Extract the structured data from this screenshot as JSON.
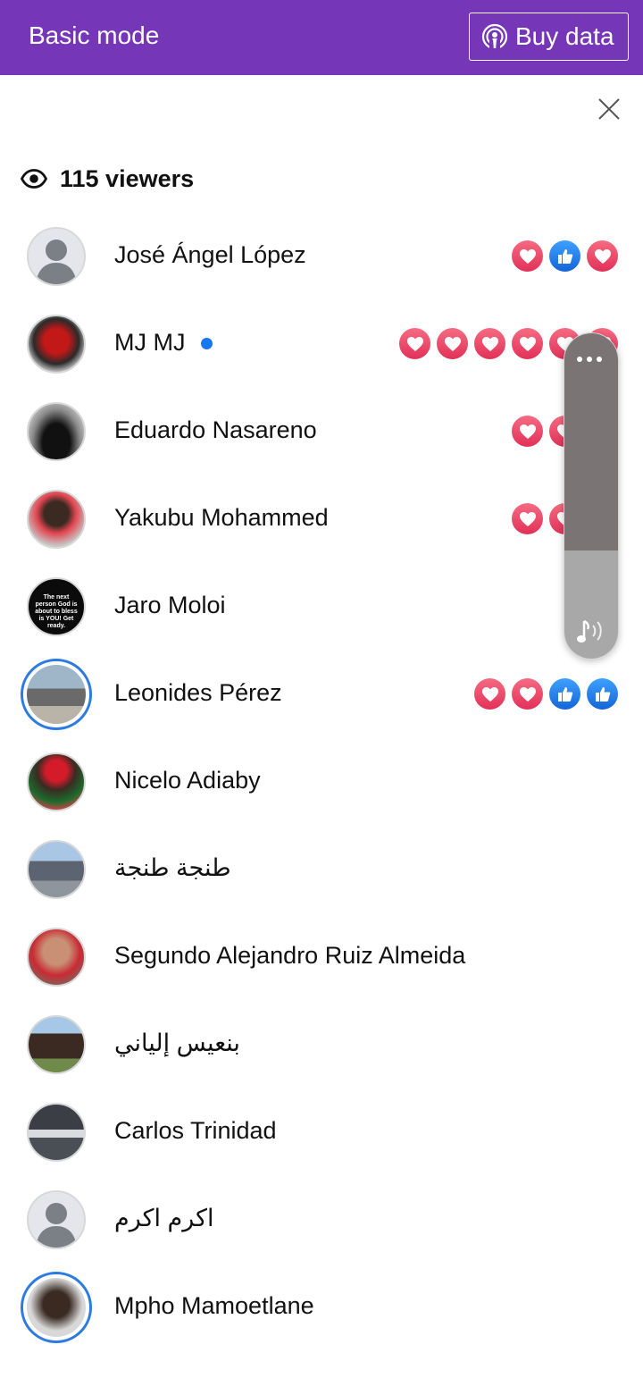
{
  "header": {
    "title": "Basic mode",
    "buy_label": "Buy data",
    "background": "#7536b7"
  },
  "viewers": {
    "count_label": "115 viewers"
  },
  "viewer_list": [
    {
      "name": "José Ángel López",
      "avatar": "default-avatar",
      "reactions": [
        "love",
        "like",
        "love"
      ]
    },
    {
      "name": "MJ MJ",
      "avatar": "red-car-photo",
      "online": true,
      "reactions": [
        "love",
        "love",
        "love",
        "love",
        "love",
        "love"
      ]
    },
    {
      "name": "Eduardo Nasareno",
      "avatar": "man-in-black-photo",
      "reactions": [
        "love",
        "love",
        "love"
      ]
    },
    {
      "name": "Yakubu Mohammed",
      "avatar": "man-portrait-photo",
      "reactions": [
        "love",
        "love",
        "love"
      ]
    },
    {
      "name": "Jaro Moloi",
      "avatar": "quote-image",
      "avatar_text": "The next person God is about to bless is YOU! Get ready.",
      "reactions": []
    },
    {
      "name": "Leonides Pérez",
      "avatar": "motorcycle-photo",
      "story_ring": true,
      "reactions": [
        "love",
        "love",
        "like",
        "like"
      ]
    },
    {
      "name": "Nicelo Adiaby",
      "avatar": "red-cap-photo",
      "reactions": []
    },
    {
      "name": "طنجة طنجة",
      "avatar": "silver-car-photo",
      "rtl": true,
      "reactions": []
    },
    {
      "name": "Segundo Alejandro Ruiz Almeida",
      "avatar": "man-red-shirt-photo",
      "reactions": []
    },
    {
      "name": "بنعيس إلياني",
      "avatar": "horse-photo",
      "rtl": true,
      "reactions": []
    },
    {
      "name": "Carlos Trinidad",
      "avatar": "trucks-photo",
      "reactions": []
    },
    {
      "name": "اكرم اكرم",
      "avatar": "default-avatar",
      "rtl": true,
      "reactions": []
    },
    {
      "name": "Mpho Mamoetlane",
      "avatar": "man-photo",
      "story_ring": true,
      "reactions": []
    }
  ],
  "colors": {
    "love": "#e8365c",
    "like": "#1877f2",
    "online": "#1877f2",
    "story_ring": "#2d7be0"
  }
}
